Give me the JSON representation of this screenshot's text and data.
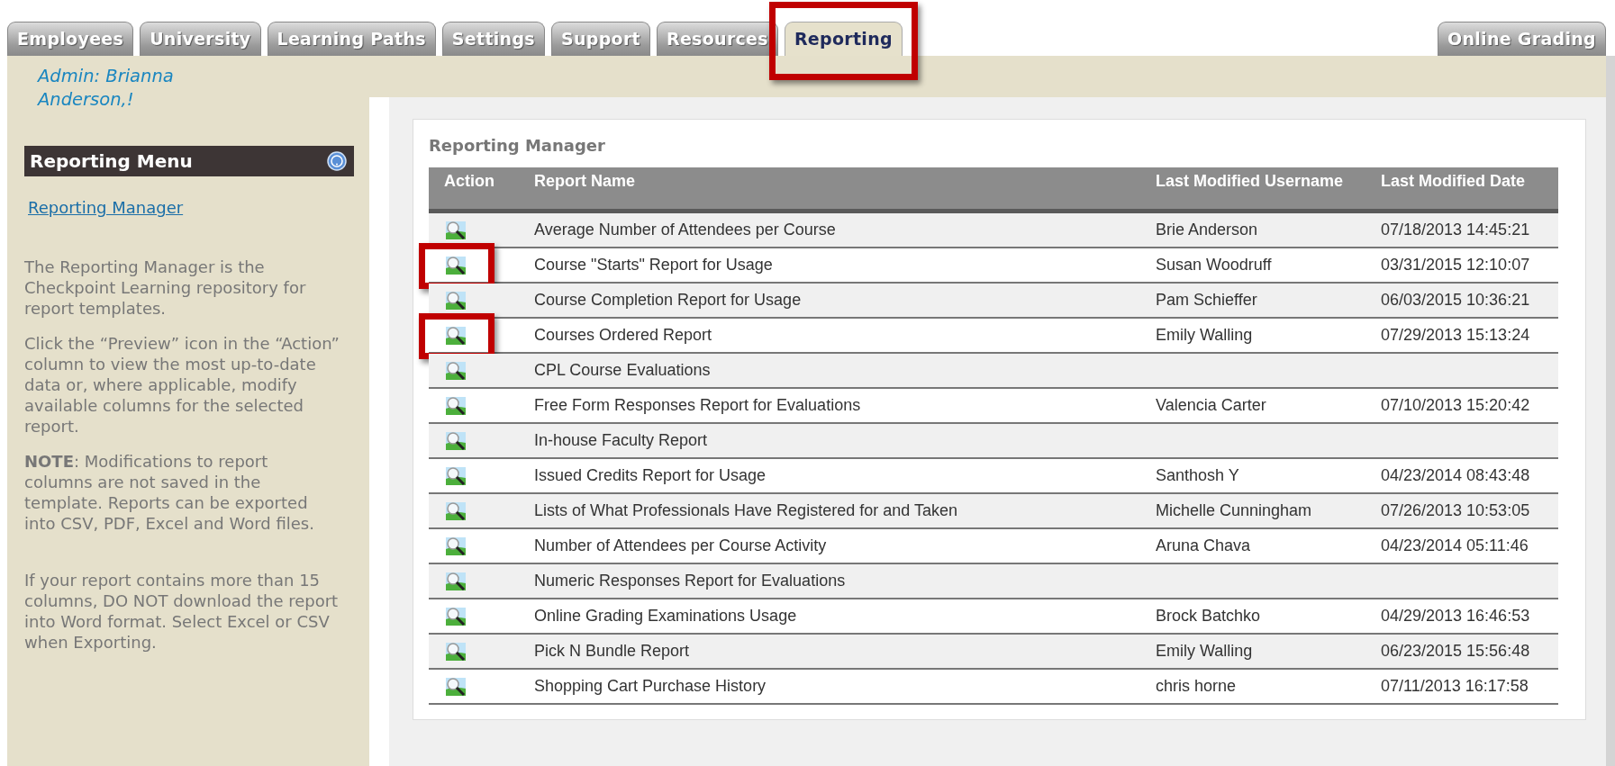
{
  "tabs": [
    {
      "label": "Employees",
      "selected": false,
      "highlighted": false
    },
    {
      "label": "University",
      "selected": false,
      "highlighted": false
    },
    {
      "label": "Learning Paths",
      "selected": false,
      "highlighted": false
    },
    {
      "label": "Settings",
      "selected": false,
      "highlighted": false
    },
    {
      "label": "Support",
      "selected": false,
      "highlighted": false
    },
    {
      "label": "Resources",
      "selected": false,
      "highlighted": false
    },
    {
      "label": "Reporting",
      "selected": true,
      "highlighted": true
    }
  ],
  "right_tab": {
    "label": "Online Grading",
    "selected": false
  },
  "sidebar": {
    "greeting": "Admin: Brianna Anderson,!",
    "menu_title": "Reporting Menu",
    "links": [
      "Reporting Manager"
    ],
    "paragraphs": [
      "The Reporting Manager is the Checkpoint Learning repository for report templates.",
      "Click the “Preview” icon in the “Action” column to view the most up-to-date data or, where applicable, modify available columns for the selected report.",
      "**NOTE**: Modifications to report columns are not saved in the template. Reports can be exported into CSV, PDF, Excel and Word files.",
      "If your report contains more than 15 columns, DO NOT download the report into Word format. Select Excel or CSV when Exporting."
    ]
  },
  "panel": {
    "title": "Reporting Manager",
    "table": {
      "columns": [
        "Action",
        "Report Name",
        "Last Modified Username",
        "Last Modified Date"
      ],
      "rows": [
        {
          "report_name": "Average Number of Attendees per Course",
          "username": "Brie Anderson",
          "date": "07/18/2013 14:45:21",
          "highlighted": false
        },
        {
          "report_name": "Course \"Starts\" Report for Usage",
          "username": "Susan Woodruff",
          "date": "03/31/2015 12:10:07",
          "highlighted": true
        },
        {
          "report_name": "Course Completion Report for Usage",
          "username": "Pam Schieffer",
          "date": "06/03/2015 10:36:21",
          "highlighted": false
        },
        {
          "report_name": "Courses Ordered Report",
          "username": "Emily Walling",
          "date": "07/29/2013 15:13:24",
          "highlighted": true
        },
        {
          "report_name": "CPL Course Evaluations",
          "highlighted": false
        },
        {
          "report_name": "Free Form Responses Report for Evaluations",
          "username": "Valencia Carter",
          "date": "07/10/2013 15:20:42",
          "highlighted": false
        },
        {
          "report_name": "In-house Faculty Report",
          "highlighted": false
        },
        {
          "report_name": "Issued Credits Report for Usage",
          "username": "Santhosh Y",
          "date": "04/23/2014 08:43:48",
          "highlighted": false
        },
        {
          "report_name": "Lists of What Professionals Have Registered for and Taken",
          "username": "Michelle Cunningham",
          "date": "07/26/2013 10:53:05",
          "highlighted": false
        },
        {
          "report_name": "Number of Attendees per Course Activity",
          "username": "Aruna Chava",
          "date": "04/23/2014 05:11:46",
          "highlighted": false
        },
        {
          "report_name": "Numeric Responses Report for Evaluations",
          "highlighted": false
        },
        {
          "report_name": "Online Grading Examinations Usage",
          "username": "Brock Batchko",
          "date": "04/29/2013 16:46:53",
          "highlighted": false
        },
        {
          "report_name": "Pick N Bundle Report",
          "username": "Emily Walling",
          "date": "06/23/2015 15:56:48",
          "highlighted": false
        },
        {
          "report_name": "Shopping Cart Purchase History",
          "username": "chris horne",
          "date": "07/11/2013 16:17:58",
          "highlighted": false
        }
      ]
    }
  }
}
